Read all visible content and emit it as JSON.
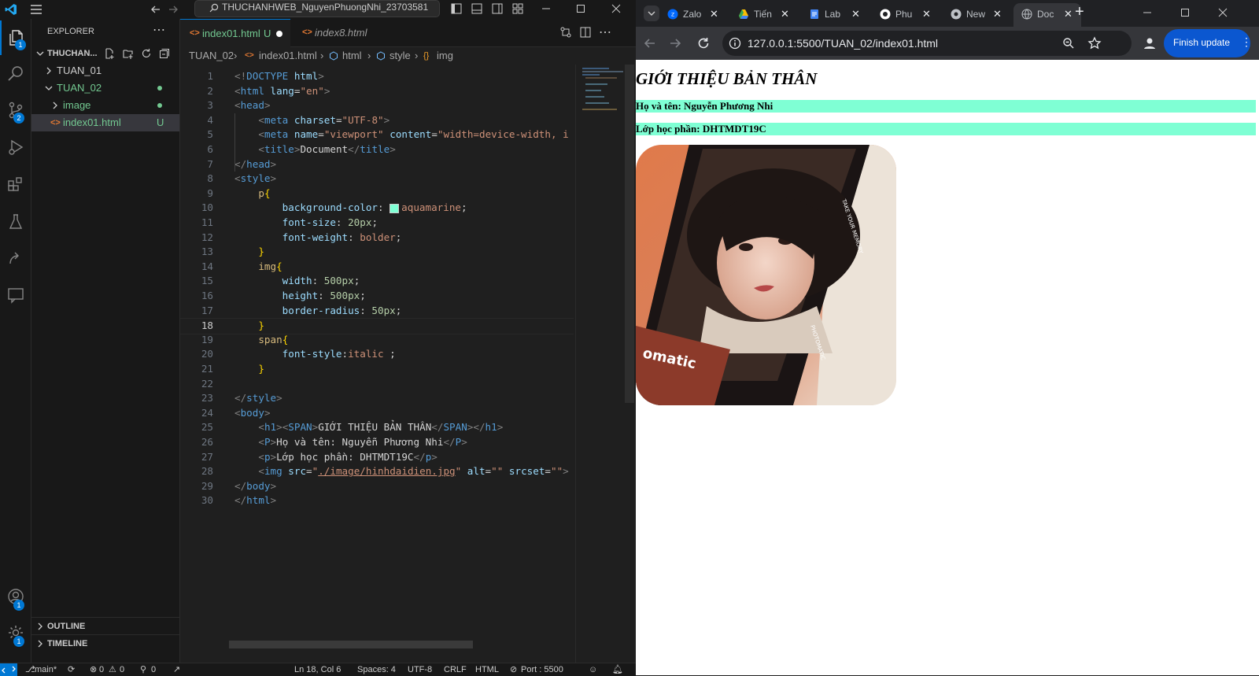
{
  "vscode": {
    "title": "THUCHANHWEB_NguyenPhuongNhi_23703581",
    "explorer": {
      "header": "EXPLORER",
      "root": "THUCHAN...",
      "items": [
        {
          "label": "TUAN_01"
        },
        {
          "label": "TUAN_02"
        },
        {
          "label": "image"
        },
        {
          "label": "index01.html",
          "status": "U"
        }
      ],
      "outline": "OUTLINE",
      "timeline": "TIMELINE"
    },
    "badges": {
      "explorer": "1",
      "scm": "2",
      "accounts": "1",
      "manage": "1"
    },
    "tabs": [
      {
        "label": "index01.html",
        "status": "U"
      },
      {
        "label": "index8.html"
      }
    ],
    "breadcrumb": [
      "TUAN_02",
      "index01.html",
      "html",
      "style",
      "img"
    ],
    "current_line": 18,
    "code": [
      {
        "n": "1",
        "tokens": [
          {
            "c": "t",
            "v": "<!"
          },
          {
            "c": "tn",
            "v": "DOCTYPE"
          },
          {
            "c": "tx",
            "v": " "
          },
          {
            "c": "at",
            "v": "html"
          },
          {
            "c": "t",
            "v": ">"
          }
        ]
      },
      {
        "n": "2",
        "tokens": [
          {
            "c": "t",
            "v": "<"
          },
          {
            "c": "tn",
            "v": "html"
          },
          {
            "c": "tx",
            "v": " "
          },
          {
            "c": "at",
            "v": "lang"
          },
          {
            "c": "tx",
            "v": "="
          },
          {
            "c": "sv",
            "v": "\"en\""
          },
          {
            "c": "t",
            "v": ">"
          }
        ]
      },
      {
        "n": "3",
        "tokens": [
          {
            "c": "t",
            "v": "<"
          },
          {
            "c": "tn",
            "v": "head"
          },
          {
            "c": "t",
            "v": ">"
          }
        ]
      },
      {
        "n": "4",
        "tokens": [
          {
            "c": "tx",
            "v": "    "
          },
          {
            "c": "t",
            "v": "<"
          },
          {
            "c": "tn",
            "v": "meta"
          },
          {
            "c": "tx",
            "v": " "
          },
          {
            "c": "at",
            "v": "charset"
          },
          {
            "c": "tx",
            "v": "="
          },
          {
            "c": "sv",
            "v": "\"UTF-8\""
          },
          {
            "c": "t",
            "v": ">"
          }
        ]
      },
      {
        "n": "5",
        "tokens": [
          {
            "c": "tx",
            "v": "    "
          },
          {
            "c": "t",
            "v": "<"
          },
          {
            "c": "tn",
            "v": "meta"
          },
          {
            "c": "tx",
            "v": " "
          },
          {
            "c": "at",
            "v": "name"
          },
          {
            "c": "tx",
            "v": "="
          },
          {
            "c": "sv",
            "v": "\"viewport\""
          },
          {
            "c": "tx",
            "v": " "
          },
          {
            "c": "at",
            "v": "content"
          },
          {
            "c": "tx",
            "v": "="
          },
          {
            "c": "sv",
            "v": "\"width=device-width, i"
          }
        ]
      },
      {
        "n": "6",
        "tokens": [
          {
            "c": "tx",
            "v": "    "
          },
          {
            "c": "t",
            "v": "<"
          },
          {
            "c": "tn",
            "v": "title"
          },
          {
            "c": "t",
            "v": ">"
          },
          {
            "c": "tx",
            "v": "Document"
          },
          {
            "c": "t",
            "v": "</"
          },
          {
            "c": "tn",
            "v": "title"
          },
          {
            "c": "t",
            "v": ">"
          }
        ]
      },
      {
        "n": "7",
        "tokens": [
          {
            "c": "t",
            "v": "</"
          },
          {
            "c": "tn",
            "v": "head"
          },
          {
            "c": "t",
            "v": ">"
          }
        ]
      },
      {
        "n": "8",
        "tokens": [
          {
            "c": "t",
            "v": "<"
          },
          {
            "c": "tn",
            "v": "style"
          },
          {
            "c": "t",
            "v": ">"
          }
        ]
      },
      {
        "n": "9",
        "tokens": [
          {
            "c": "tx",
            "v": "    "
          },
          {
            "c": "sel",
            "v": "p"
          },
          {
            "c": "br",
            "v": "{"
          }
        ]
      },
      {
        "n": "10",
        "tokens": [
          {
            "c": "tx",
            "v": "        "
          },
          {
            "c": "pr",
            "v": "background-color"
          },
          {
            "c": "tx",
            "v": ": "
          },
          {
            "c": "swatch",
            "v": ""
          },
          {
            "c": "kw",
            "v": "aquamarine"
          },
          {
            "c": "tx",
            "v": ";"
          }
        ]
      },
      {
        "n": "11",
        "tokens": [
          {
            "c": "tx",
            "v": "        "
          },
          {
            "c": "pr",
            "v": "font-size"
          },
          {
            "c": "tx",
            "v": ": "
          },
          {
            "c": "nm",
            "v": "20px"
          },
          {
            "c": "tx",
            "v": ";"
          }
        ]
      },
      {
        "n": "12",
        "tokens": [
          {
            "c": "tx",
            "v": "        "
          },
          {
            "c": "pr",
            "v": "font-weight"
          },
          {
            "c": "tx",
            "v": ": "
          },
          {
            "c": "kw",
            "v": "bolder"
          },
          {
            "c": "tx",
            "v": ";"
          }
        ]
      },
      {
        "n": "13",
        "tokens": [
          {
            "c": "tx",
            "v": "    "
          },
          {
            "c": "br",
            "v": "}"
          }
        ]
      },
      {
        "n": "14",
        "tokens": [
          {
            "c": "tx",
            "v": "    "
          },
          {
            "c": "sel",
            "v": "img"
          },
          {
            "c": "br",
            "v": "{"
          }
        ]
      },
      {
        "n": "15",
        "tokens": [
          {
            "c": "tx",
            "v": "        "
          },
          {
            "c": "pr",
            "v": "width"
          },
          {
            "c": "tx",
            "v": ": "
          },
          {
            "c": "nm",
            "v": "500px"
          },
          {
            "c": "tx",
            "v": ";"
          }
        ]
      },
      {
        "n": "16",
        "tokens": [
          {
            "c": "tx",
            "v": "        "
          },
          {
            "c": "pr",
            "v": "height"
          },
          {
            "c": "tx",
            "v": ": "
          },
          {
            "c": "nm",
            "v": "500px"
          },
          {
            "c": "tx",
            "v": ";"
          }
        ]
      },
      {
        "n": "17",
        "tokens": [
          {
            "c": "tx",
            "v": "        "
          },
          {
            "c": "pr",
            "v": "border-radius"
          },
          {
            "c": "tx",
            "v": ": "
          },
          {
            "c": "nm",
            "v": "50px"
          },
          {
            "c": "tx",
            "v": ";"
          }
        ]
      },
      {
        "n": "18",
        "tokens": [
          {
            "c": "tx",
            "v": "    "
          },
          {
            "c": "br",
            "v": "}"
          }
        ]
      },
      {
        "n": "19",
        "tokens": [
          {
            "c": "tx",
            "v": "    "
          },
          {
            "c": "sel",
            "v": "span"
          },
          {
            "c": "br",
            "v": "{"
          }
        ]
      },
      {
        "n": "20",
        "tokens": [
          {
            "c": "tx",
            "v": "        "
          },
          {
            "c": "pr",
            "v": "font-style"
          },
          {
            "c": "tx",
            "v": ":"
          },
          {
            "c": "kw",
            "v": "italic"
          },
          {
            "c": "tx",
            "v": " ;"
          }
        ]
      },
      {
        "n": "21",
        "tokens": [
          {
            "c": "tx",
            "v": "    "
          },
          {
            "c": "br",
            "v": "}"
          }
        ]
      },
      {
        "n": "22",
        "tokens": []
      },
      {
        "n": "23",
        "tokens": [
          {
            "c": "t",
            "v": "</"
          },
          {
            "c": "tn",
            "v": "style"
          },
          {
            "c": "t",
            "v": ">"
          }
        ]
      },
      {
        "n": "24",
        "tokens": [
          {
            "c": "t",
            "v": "<"
          },
          {
            "c": "tn",
            "v": "body"
          },
          {
            "c": "t",
            "v": ">"
          }
        ]
      },
      {
        "n": "25",
        "tokens": [
          {
            "c": "tx",
            "v": "    "
          },
          {
            "c": "t",
            "v": "<"
          },
          {
            "c": "tn",
            "v": "h1"
          },
          {
            "c": "t",
            "v": "><"
          },
          {
            "c": "tn",
            "v": "SPAN"
          },
          {
            "c": "t",
            "v": ">"
          },
          {
            "c": "tx",
            "v": "GIỚI THIỆU BẢN THÂN"
          },
          {
            "c": "t",
            "v": "</"
          },
          {
            "c": "tn",
            "v": "SPAN"
          },
          {
            "c": "t",
            "v": "></"
          },
          {
            "c": "tn",
            "v": "h1"
          },
          {
            "c": "t",
            "v": ">"
          }
        ]
      },
      {
        "n": "26",
        "tokens": [
          {
            "c": "tx",
            "v": "    "
          },
          {
            "c": "t",
            "v": "<"
          },
          {
            "c": "tn",
            "v": "P"
          },
          {
            "c": "t",
            "v": ">"
          },
          {
            "c": "tx",
            "v": "Họ và tên: Nguyễn Phương Nhi"
          },
          {
            "c": "t",
            "v": "</"
          },
          {
            "c": "tn",
            "v": "P"
          },
          {
            "c": "t",
            "v": ">"
          }
        ]
      },
      {
        "n": "27",
        "tokens": [
          {
            "c": "tx",
            "v": "    "
          },
          {
            "c": "t",
            "v": "<"
          },
          {
            "c": "tn",
            "v": "p"
          },
          {
            "c": "t",
            "v": ">"
          },
          {
            "c": "tx",
            "v": "Lớp học phần: DHTMDT19C"
          },
          {
            "c": "t",
            "v": "</"
          },
          {
            "c": "tn",
            "v": "p"
          },
          {
            "c": "t",
            "v": ">"
          }
        ]
      },
      {
        "n": "28",
        "tokens": [
          {
            "c": "tx",
            "v": "    "
          },
          {
            "c": "t",
            "v": "<"
          },
          {
            "c": "tn",
            "v": "img"
          },
          {
            "c": "tx",
            "v": " "
          },
          {
            "c": "at",
            "v": "src"
          },
          {
            "c": "tx",
            "v": "="
          },
          {
            "c": "sv",
            "v": "\""
          },
          {
            "c": "link",
            "v": "./image/hinhdaidien.jpg"
          },
          {
            "c": "sv",
            "v": "\""
          },
          {
            "c": "tx",
            "v": " "
          },
          {
            "c": "at",
            "v": "alt"
          },
          {
            "c": "tx",
            "v": "="
          },
          {
            "c": "sv",
            "v": "\"\""
          },
          {
            "c": "tx",
            "v": " "
          },
          {
            "c": "at",
            "v": "srcset"
          },
          {
            "c": "tx",
            "v": "="
          },
          {
            "c": "sv",
            "v": "\"\""
          },
          {
            "c": "t",
            "v": ">"
          }
        ]
      },
      {
        "n": "29",
        "tokens": [
          {
            "c": "t",
            "v": "</"
          },
          {
            "c": "tn",
            "v": "body"
          },
          {
            "c": "t",
            "v": ">"
          }
        ]
      },
      {
        "n": "30",
        "tokens": [
          {
            "c": "t",
            "v": "</"
          },
          {
            "c": "tn",
            "v": "html"
          },
          {
            "c": "t",
            "v": ">"
          }
        ]
      }
    ],
    "status": {
      "branch": "main*",
      "problems": "0",
      "warnings": "0",
      "ports": "0",
      "cursor": "Ln 18, Col 6",
      "spaces": "Spaces: 4",
      "encoding": "UTF-8",
      "eol": "CRLF",
      "language": "HTML",
      "port": "Port : 5500"
    }
  },
  "chrome": {
    "tabs": [
      {
        "label": "Zalo",
        "icon": "zalo-icon",
        "color": "#0068ff"
      },
      {
        "label": "Tiến",
        "icon": "drive-icon",
        "color": "#fbbc04"
      },
      {
        "label": "Lab",
        "icon": "docs-icon",
        "color": "#4285f4"
      },
      {
        "label": "Phu",
        "icon": "github-icon",
        "color": "#ffffff"
      },
      {
        "label": "New",
        "icon": "chrome-icon",
        "color": "#bdc1c6"
      },
      {
        "label": "Doc",
        "icon": "globe-icon",
        "color": "#bdc1c6",
        "active": true
      }
    ],
    "url": "127.0.0.1:5500/TUAN_02/index01.html",
    "finish_update": "Finish update",
    "page": {
      "heading": "GIỚI THIỆU BẢN THÂN",
      "name_line": "Họ và tên: Nguyễn Phương Nhi",
      "class_line": "Lớp học phần: DHTMDT19C",
      "photo_caption": "omatic",
      "photo_side_text": "TAKE YOUR MEMORY",
      "photo_brand": "PHOTOMATIC",
      "paragraph_color": "#7fffd4"
    }
  },
  "colors": {
    "accent": "#0078d4",
    "untracked": "#73c991",
    "code_bg": "#1f1f1f",
    "aquamarine": "#7fffd4"
  }
}
